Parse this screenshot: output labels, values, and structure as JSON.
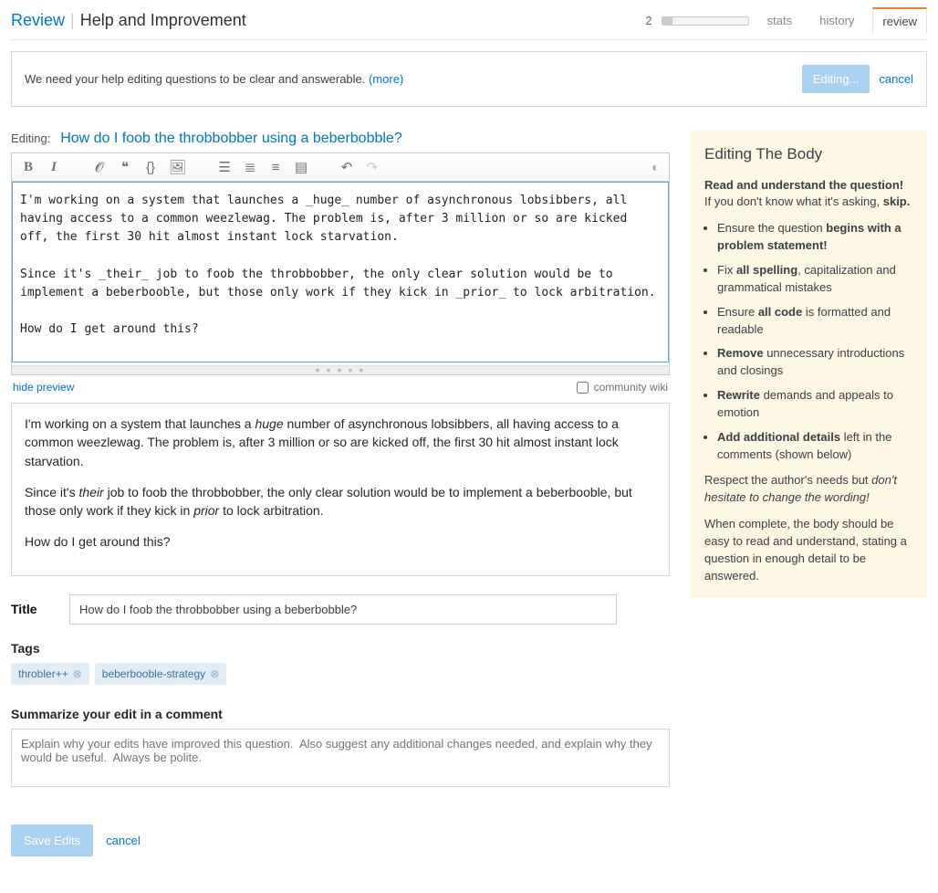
{
  "header": {
    "review": "Review",
    "section": "Help and Improvement",
    "count": "2",
    "tabs": {
      "stats": "stats",
      "history": "history",
      "review": "review"
    }
  },
  "banner": {
    "text": "We need your help editing questions to be clear and answerable. ",
    "more": "(more)",
    "editing_btn": "Editing...",
    "cancel": "cancel"
  },
  "editing": {
    "label": "Editing:",
    "question_link": "How do I foob the throbbobber using a beberbobble?"
  },
  "toolbar": {
    "help": "?"
  },
  "body_raw": "I'm working on a system that launches a _huge_ number of asynchronous lobsibbers, all having access to a common weezlewag. The problem is, after 3 million or so are kicked off, the first 30 hit almost instant lock starvation.\n\nSince it's _their_ job to foob the throbbobber, the only clear solution would be to implement a beberbooble, but those only work if they kick in _prior_ to lock arbitration.\n\nHow do I get around this?",
  "below": {
    "hide": "hide preview",
    "cw": "community wiki"
  },
  "preview": {
    "p1a": "I'm working on a system that launches a ",
    "p1i": "huge",
    "p1b": " number of asynchronous lobsibbers, all having access to a common weezlewag. The problem is, after 3 million or so are kicked off, the first 30 hit almost instant lock starvation.",
    "p2a": "Since it's ",
    "p2i": "their",
    "p2b": " job to foob the throbbobber, the only clear solution would be to implement a beberbooble, but those only work if they kick in ",
    "p2i2": "prior",
    "p2c": " to lock arbitration.",
    "p3": "How do I get around this?"
  },
  "title": {
    "label": "Title",
    "value": "How do I foob the throbbobber using a beberbobble?"
  },
  "tags": {
    "label": "Tags",
    "items": [
      "throbler++",
      "beberbooble-strategy"
    ]
  },
  "summary": {
    "label": "Summarize your edit in a comment",
    "placeholder": "Explain why your edits have improved this question.  Also suggest any additional changes needed, and explain why they would be useful.  Always be polite."
  },
  "footer": {
    "save": "Save Edits",
    "cancel": "cancel"
  },
  "sidebar": {
    "title": "Editing The Body",
    "lead_b": "Read and understand the question!",
    "lead_r": " If you don't know what it's asking, ",
    "lead_skip": "skip.",
    "li1a": "Ensure the question ",
    "li1b": "begins with a problem statement!",
    "li2a": "Fix ",
    "li2b": "all spelling",
    "li2c": ", capitalization and grammatical mistakes",
    "li3a": "Ensure ",
    "li3b": "all code",
    "li3c": " is formatted and readable",
    "li4b": "Remove",
    "li4c": " unnecessary introductions and closings",
    "li5b": "Rewrite",
    "li5c": " demands and appeals to emotion",
    "li6b": "Add additional details",
    "li6c": " left in the comments (shown below)",
    "respect_a": "Respect the author's needs but ",
    "respect_i": "don't hesitate to change the wording!",
    "final": "When complete, the body should be easy to read and understand, stating a question in enough detail to be answered."
  }
}
